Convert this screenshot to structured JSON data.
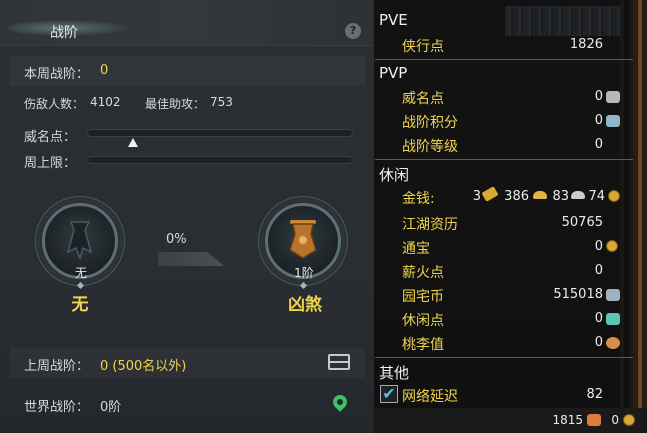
{
  "left_panel": {
    "title": "战阶",
    "help": "?",
    "weekly_rank_label": "本周战阶：",
    "weekly_rank_value": "0",
    "kills_label": "伤敌人数：",
    "kills_value": "4102",
    "assist_label": "最佳助攻：",
    "assist_value": "753",
    "prestige_label": "威名点：",
    "prestige_progress": 0.17,
    "weekly_cap_label": "周上限：",
    "weekly_cap_progress": 0,
    "current_emblem_label": "无",
    "current_rank_name": "无",
    "progress_percent": "0%",
    "next_emblem_label": "1阶",
    "next_rank_name": "凶煞",
    "last_week_label": "上周战阶：",
    "last_week_value": "0 (500名以外)",
    "world_rank_label": "世界战阶：",
    "world_rank_value": "0阶"
  },
  "right_panel": {
    "pve": {
      "title": "PVE",
      "items": [
        {
          "label": "侠行点",
          "value": "1826"
        }
      ]
    },
    "pvp": {
      "title": "PVP",
      "items": [
        {
          "label": "威名点",
          "value": "0"
        },
        {
          "label": "战阶积分",
          "value": "0"
        },
        {
          "label": "战阶等级",
          "value": "0"
        }
      ]
    },
    "leisure": {
      "title": "休闲",
      "money_label": "金钱:",
      "money_gold": "3",
      "money_silver": "386",
      "money_copper": "83",
      "money_other": "74",
      "items": [
        {
          "label": "江湖资历",
          "value": "50765"
        },
        {
          "label": "通宝",
          "value": "0"
        },
        {
          "label": "薪火点",
          "value": "0"
        },
        {
          "label": "园宅币",
          "value": "515018"
        },
        {
          "label": "休闲点",
          "value": "0"
        },
        {
          "label": "桃李值",
          "value": "0"
        }
      ]
    },
    "other": {
      "title": "其他",
      "latency_label": "网络延迟",
      "latency_value": "82",
      "latency_checked": true
    },
    "bottom": {
      "value1": "1815",
      "value2": "0"
    }
  },
  "colors": {
    "accent_yellow": "#f1d44a",
    "bg_dark": "#2a2e32"
  }
}
